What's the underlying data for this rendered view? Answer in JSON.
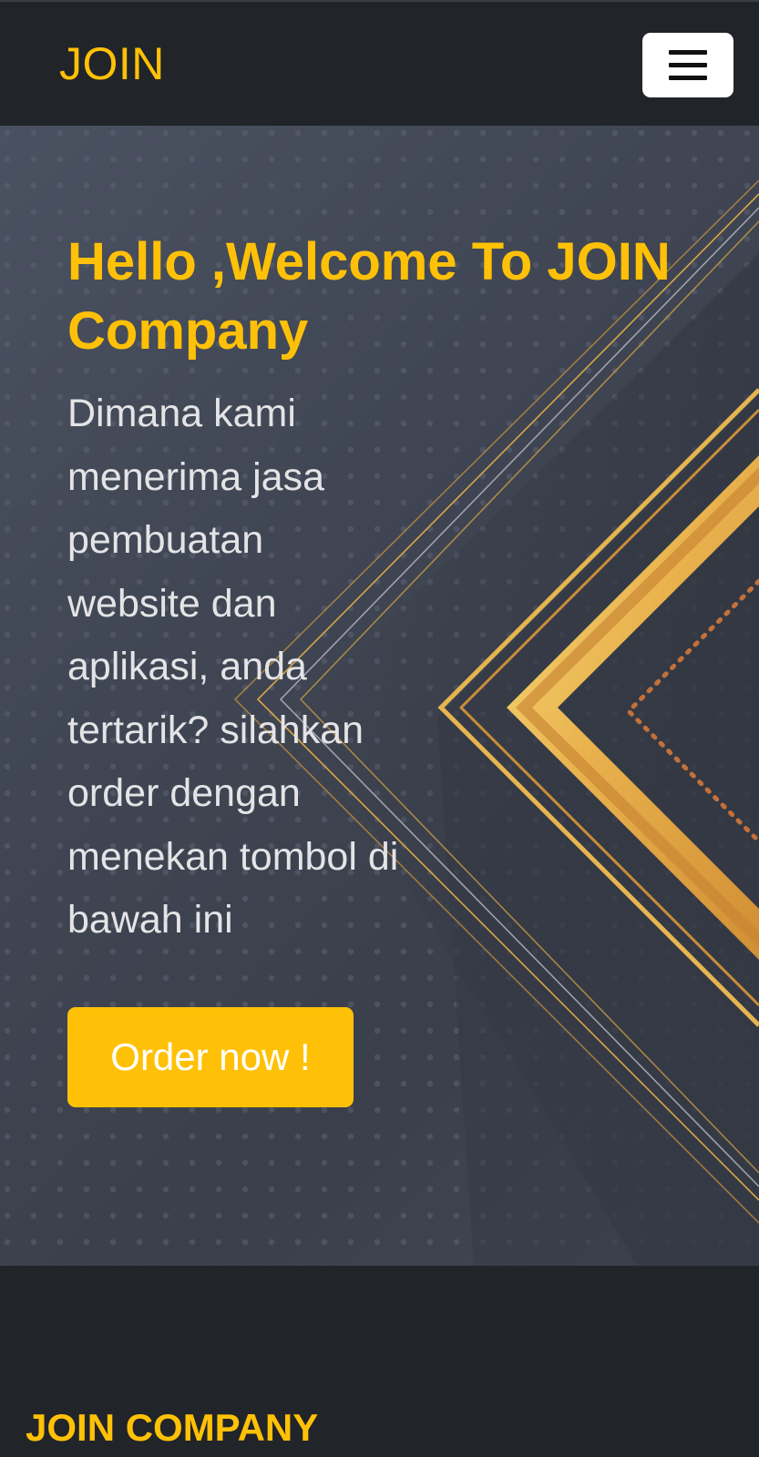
{
  "navbar": {
    "brand": "JOIN",
    "toggler_icon": "hamburger-menu-icon"
  },
  "hero": {
    "title": "Hello ,Welcome To JOIN Company",
    "text": "Dimana kami menerima jasa pembuatan website dan aplikasi, anda tertarik? silahkan order dengan menekan tombol di bawah ini",
    "button_label": "Order now !"
  },
  "footer": {
    "title": "JOIN COMPANY"
  },
  "colors": {
    "accent": "#ffc107",
    "dark": "#212429",
    "hero_bg": "#3f4552",
    "gold": "#e8b04a"
  }
}
